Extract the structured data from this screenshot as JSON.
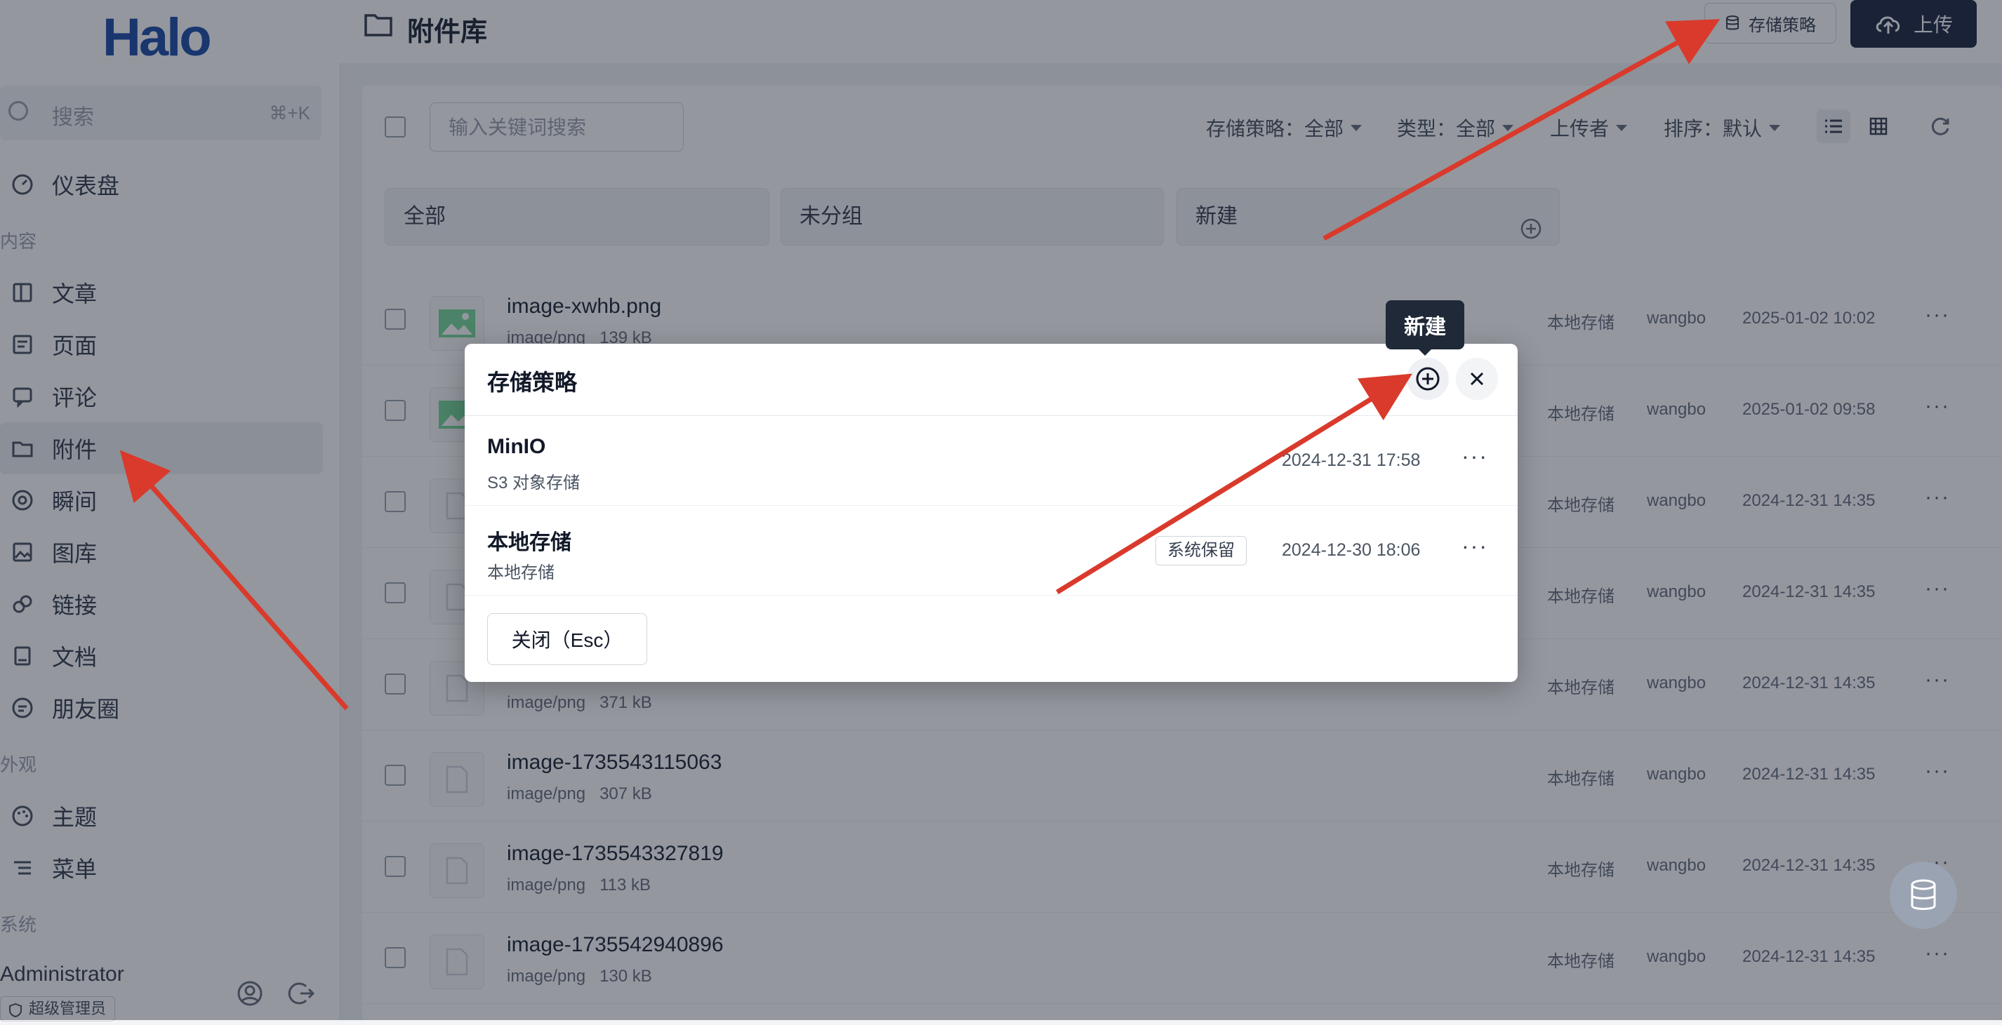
{
  "app": {
    "logo": "Halo"
  },
  "sidebar": {
    "search_placeholder": "搜索",
    "search_shortcut": "⌘+K",
    "items": [
      {
        "label": "仪表盘",
        "icon": "dashboard-icon"
      },
      {
        "label": "文章",
        "icon": "article-icon"
      },
      {
        "label": "页面",
        "icon": "page-icon"
      },
      {
        "label": "评论",
        "icon": "comment-icon"
      },
      {
        "label": "附件",
        "icon": "folder-icon"
      },
      {
        "label": "瞬间",
        "icon": "moments-icon"
      },
      {
        "label": "图库",
        "icon": "gallery-icon"
      },
      {
        "label": "链接",
        "icon": "link-icon"
      },
      {
        "label": "文档",
        "icon": "doc-icon"
      },
      {
        "label": "朋友圈",
        "icon": "friends-icon"
      },
      {
        "label": "主题",
        "icon": "palette-icon"
      },
      {
        "label": "菜单",
        "icon": "menu-icon"
      }
    ],
    "groups": {
      "content": "内容",
      "appearance": "外观",
      "system": "系统"
    },
    "user": {
      "name": "Administrator",
      "role": "超级管理员"
    }
  },
  "header": {
    "title": "附件库",
    "policy_button": "存储策略",
    "upload_button": "上传"
  },
  "toolbar": {
    "keyword_placeholder": "输入关键词搜索",
    "filter_policy": "存储策略：全部",
    "filter_type": "类型：全部",
    "filter_uploader": "上传者",
    "filter_sort": "排序：默认"
  },
  "groups": {
    "all": "全部",
    "ungrouped": "未分组",
    "new": "新建"
  },
  "attachments": [
    {
      "name": "image-xwhb.png",
      "meta": "image/png   139 kB",
      "store": "本地存储",
      "user": "wangbo",
      "date": "2025-01-02 10:02"
    },
    {
      "name": "",
      "meta": "",
      "store": "本地存储",
      "user": "wangbo",
      "date": "2025-01-02 09:58"
    },
    {
      "name": "",
      "meta": "",
      "store": "本地存储",
      "user": "wangbo",
      "date": "2024-12-31 14:35"
    },
    {
      "name": "",
      "meta": "",
      "store": "本地存储",
      "user": "wangbo",
      "date": "2024-12-31 14:35"
    },
    {
      "name": "",
      "meta": "image/png   371 kB",
      "store": "本地存储",
      "user": "wangbo",
      "date": "2024-12-31 14:35"
    },
    {
      "name": "image-1735543115063",
      "meta": "image/png   307 kB",
      "store": "本地存储",
      "user": "wangbo",
      "date": "2024-12-31 14:35"
    },
    {
      "name": "image-1735543327819",
      "meta": "image/png   113 kB",
      "store": "本地存储",
      "user": "wangbo",
      "date": "2024-12-31 14:35"
    },
    {
      "name": "image-1735542940896",
      "meta": "image/png   130 kB",
      "store": "本地存储",
      "user": "wangbo",
      "date": "2024-12-31 14:35"
    }
  ],
  "modal": {
    "title": "存储策略",
    "tooltip": "新建",
    "policies": [
      {
        "name": "MinIO",
        "type": "S3 对象存储",
        "badge": "",
        "date": "2024-12-31 17:58"
      },
      {
        "name": "本地存储",
        "type": "本地存储",
        "badge": "系统保留",
        "date": "2024-12-30 18:06"
      }
    ],
    "close_button": "关闭（Esc）"
  },
  "colors": {
    "brand": "#1f4fa8",
    "annotation_arrow": "#d93a2b",
    "primary_button": "#1f2a44"
  }
}
